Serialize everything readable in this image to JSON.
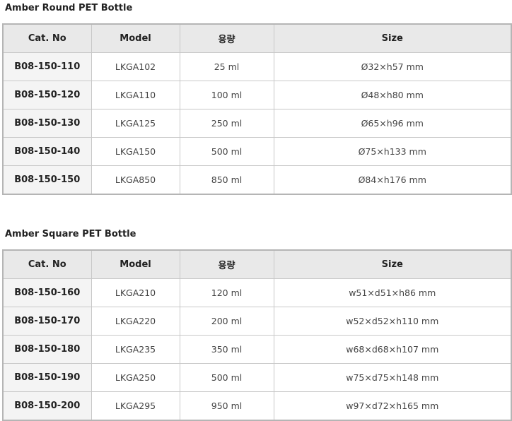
{
  "sections": [
    {
      "title": "Amber Round PET Bottle",
      "headers": [
        "Cat. No",
        "Model",
        "용량",
        "Size"
      ],
      "rows": [
        [
          "B08-150-110",
          "LKGA102",
          "25 ml",
          "Ø32×h57 mm"
        ],
        [
          "B08-150-120",
          "LKGA110",
          "100 ml",
          "Ø48×h80 mm"
        ],
        [
          "B08-150-130",
          "LKGA125",
          "250 ml",
          "Ø65×h96 mm"
        ],
        [
          "B08-150-140",
          "LKGA150",
          "500 ml",
          "Ø75×h133 mm"
        ],
        [
          "B08-150-150",
          "LKGA850",
          "850 ml",
          "Ø84×h176 mm"
        ]
      ]
    },
    {
      "title": "Amber Square PET Bottle",
      "headers": [
        "Cat. No",
        "Model",
        "용량",
        "Size"
      ],
      "rows": [
        [
          "B08-150-160",
          "LKGA210",
          "120 ml",
          "w51×d51×h86 mm"
        ],
        [
          "B08-150-170",
          "LKGA220",
          "200 ml",
          "w52×d52×h110 mm"
        ],
        [
          "B08-150-180",
          "LKGA235",
          "350 ml",
          "w68×d68×h107 mm"
        ],
        [
          "B08-150-190",
          "LKGA250",
          "500 ml",
          "w75×d75×h148 mm"
        ],
        [
          "B08-150-200",
          "LKGA295",
          "950 ml",
          "w97×d72×h165 mm"
        ]
      ]
    }
  ]
}
